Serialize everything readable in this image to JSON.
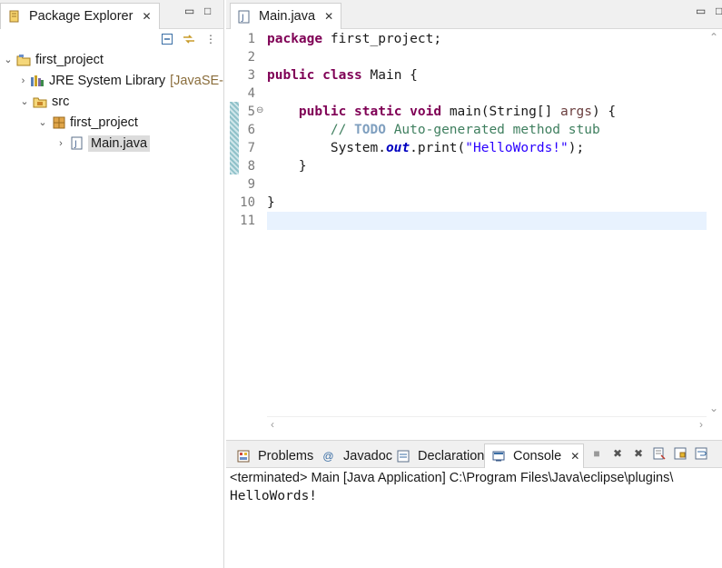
{
  "package_explorer": {
    "tab_label": "Package Explorer",
    "tree": [
      {
        "label": "first_project",
        "decoration": ""
      },
      {
        "label": "JRE System Library",
        "decoration": "[JavaSE-"
      },
      {
        "label": "src",
        "decoration": ""
      },
      {
        "label": "first_project",
        "decoration": ""
      },
      {
        "label": "Main.java",
        "decoration": ""
      }
    ]
  },
  "editor": {
    "tab_label": "Main.java",
    "line_numbers": [
      "1",
      "2",
      "3",
      "4",
      "5",
      "6",
      "7",
      "8",
      "9",
      "10",
      "11"
    ],
    "lines": {
      "l1_kw": "package",
      "l1_rest": " first_project;",
      "l3_kw1": "public",
      "l3_kw2": "class",
      "l3_rest": " Main {",
      "l5_indent": "    ",
      "l5_kw1": "public",
      "l5_kw2": "static",
      "l5_kw3": "void",
      "l5_mid": " main(String[] ",
      "l5_param": "args",
      "l5_end": ") {",
      "l6_indent": "        ",
      "l6_comment": "// ",
      "l6_todo": "TODO",
      "l6_rest": " Auto-generated method stub",
      "l7_indent": "        ",
      "l7_a": "System.",
      "l7_field": "out",
      "l7_b": ".print(",
      "l7_str": "\"HelloWords!\"",
      "l7_c": ");",
      "l8": "    }",
      "l10": "}"
    }
  },
  "console": {
    "tabs": {
      "problems": "Problems",
      "javadoc": "Javadoc",
      "declaration": "Declaration",
      "console": "Console"
    },
    "header": "<terminated> Main [Java Application] C:\\Program Files\\Java\\eclipse\\plugins\\",
    "output": "HelloWords!"
  },
  "colors": {
    "keyword": "#7f0055",
    "comment": "#3f7f5f",
    "string": "#2a00ff",
    "current_line": "#e8f2fe"
  }
}
